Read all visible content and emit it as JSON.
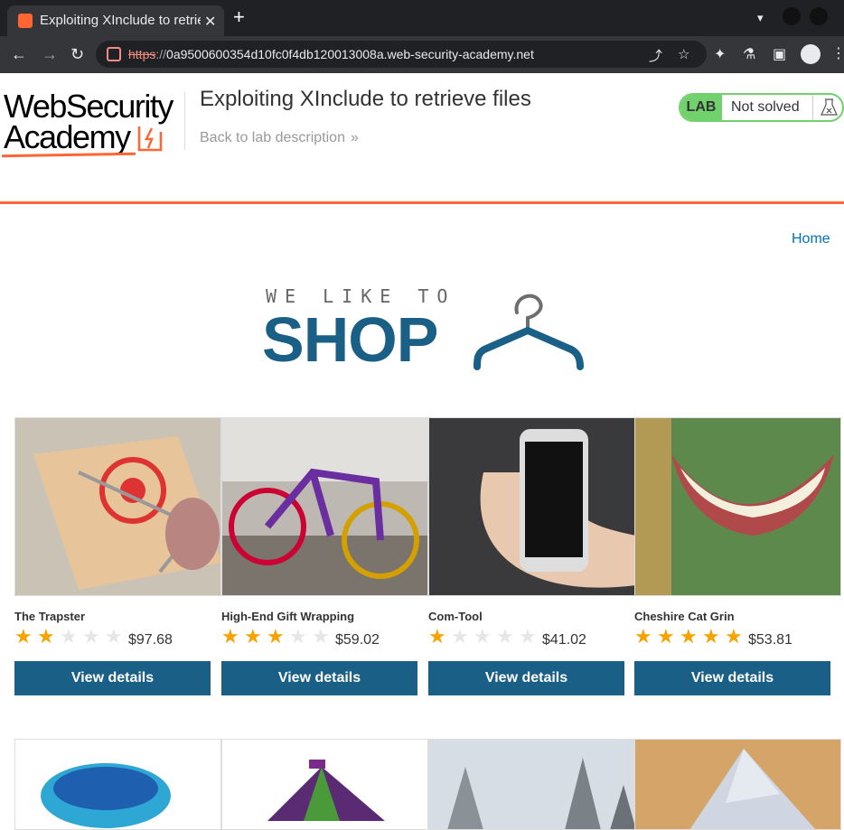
{
  "browser": {
    "tab_title": "Exploiting XInclude to retrieve files",
    "close_glyph": "✕",
    "new_tab_glyph": "+",
    "url_scheme": "https",
    "url_sep": "://",
    "url_host": "0a9500600354d10fc0f4db120013008a.web-security-academy.net",
    "icons": [
      "back-icon",
      "forward-icon",
      "reload-icon",
      "share-icon",
      "star-icon",
      "extensions-icon",
      "labs-icon",
      "sidepanel-icon",
      "profile-icon",
      "menu-icon"
    ]
  },
  "header": {
    "logo_line1": "WebSecurity",
    "logo_line2": "Academy",
    "lab_title": "Exploiting XInclude to retrieve files",
    "back_link": "Back to lab description",
    "lab_badge": "LAB",
    "lab_status": "Not solved"
  },
  "nav": {
    "home": "Home"
  },
  "banner": {
    "line1": "WE LIKE TO",
    "line2": "SHOP"
  },
  "colors": {
    "accent": "#ff6633",
    "brand_blue": "#1a5f86",
    "lab_green": "#70d16d",
    "star_on": "#f6a200",
    "star_off": "#e6e6e6"
  },
  "products": [
    {
      "name": "The Trapster",
      "rating": 2,
      "price": "$97.68",
      "button": "View details",
      "image": "mousetrap"
    },
    {
      "name": "High-End Gift Wrapping",
      "rating": 3,
      "price": "$59.02",
      "button": "View details",
      "image": "knitted-bicycle"
    },
    {
      "name": "Com-Tool",
      "rating": 1,
      "price": "$41.02",
      "button": "View details",
      "image": "phone-in-hand"
    },
    {
      "name": "Cheshire Cat Grin",
      "rating": 5,
      "price": "$53.81",
      "button": "View details",
      "image": "cat-grin"
    },
    {
      "name": "",
      "image": "paddling-pool"
    },
    {
      "name": "",
      "image": "circus-tent"
    },
    {
      "name": "",
      "image": "snowy-trees"
    },
    {
      "name": "",
      "image": "paper-swan"
    }
  ]
}
